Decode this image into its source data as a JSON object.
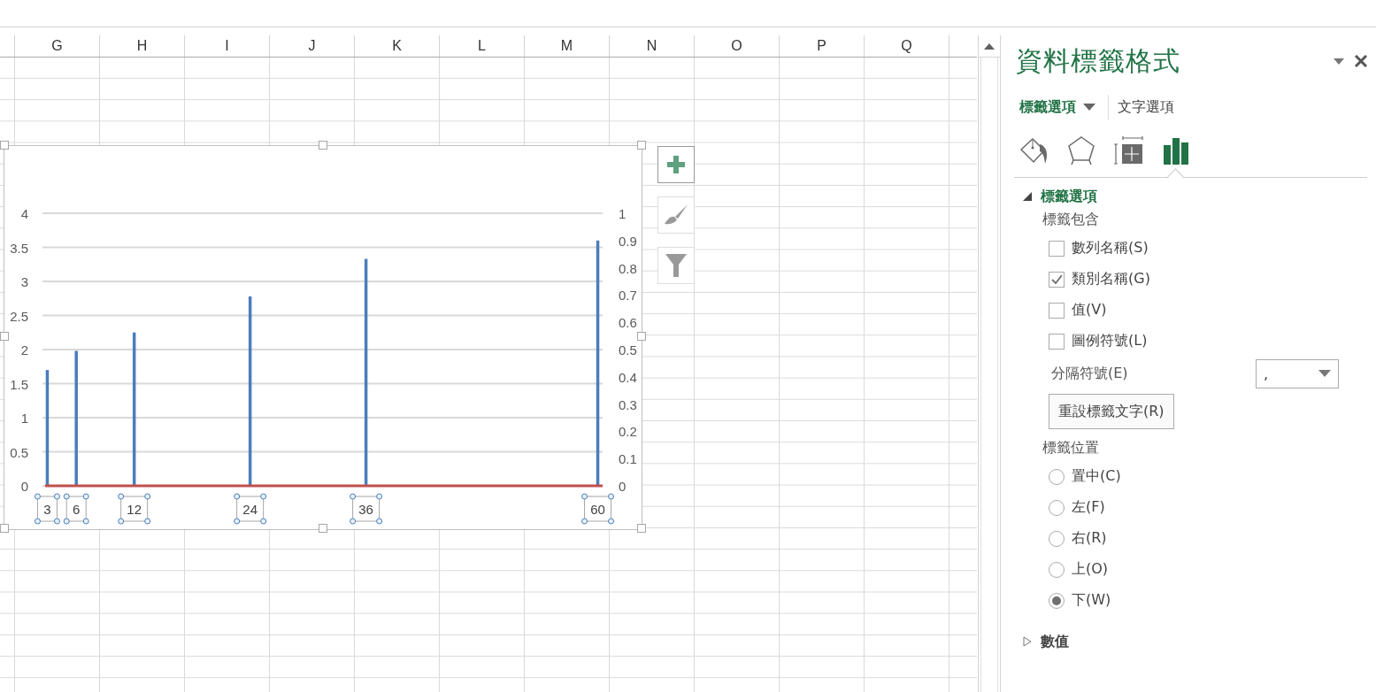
{
  "sheet": {
    "columns": [
      "G",
      "H",
      "I",
      "J",
      "K",
      "L",
      "M",
      "N",
      "O",
      "P",
      "Q"
    ]
  },
  "chart": {
    "right_axis_labels": [
      "1",
      "0.9",
      "0.8",
      "0.7",
      "0.6",
      "0.5",
      "0.4",
      "0.3",
      "0.2",
      "0.1",
      "0"
    ],
    "chart_data": {
      "type": "bar",
      "grid": true,
      "x": [
        3,
        6,
        12,
        24,
        36,
        60
      ],
      "xlim": [
        2.5,
        60.5
      ],
      "ylim": [
        0,
        4
      ],
      "xticks": [
        {
          "value": 3,
          "label": "3"
        },
        {
          "value": 6,
          "label": "6"
        },
        {
          "value": 12,
          "label": "12"
        },
        {
          "value": 24,
          "label": "24"
        },
        {
          "value": 36,
          "label": "36"
        },
        {
          "value": 60,
          "label": "60"
        }
      ],
      "yticks": [
        {
          "value": 0,
          "label": "0"
        },
        {
          "value": 0.5,
          "label": "0.5"
        },
        {
          "value": 1,
          "label": "1"
        },
        {
          "value": 1.5,
          "label": "1.5"
        },
        {
          "value": 2,
          "label": "2"
        },
        {
          "value": 2.5,
          "label": "2.5"
        },
        {
          "value": 3,
          "label": "3"
        },
        {
          "value": 3.5,
          "label": "3.5"
        },
        {
          "value": 4,
          "label": "4"
        }
      ],
      "series": [
        {
          "color": "#4a7ebb",
          "values": [
            1.7,
            1.98,
            2.25,
            2.78,
            3.33,
            3.6
          ]
        },
        {
          "color": "#c0504d",
          "values": [
            0,
            0,
            0,
            0,
            0,
            0
          ]
        }
      ]
    }
  },
  "panel": {
    "title": "資料標籤格式",
    "tabs": [
      {
        "label": "標籤選項",
        "selected": true
      },
      {
        "label": "文字選項",
        "selected": false
      }
    ],
    "icon_tabs": [
      {
        "kind": "fill",
        "selected": false
      },
      {
        "kind": "effects",
        "selected": false
      },
      {
        "kind": "size",
        "selected": false
      },
      {
        "kind": "options",
        "selected": true
      }
    ],
    "sections": [
      {
        "title": "標籤選項",
        "expanded": true,
        "contains_label": "標籤包含",
        "checkboxes": [
          {
            "label": "數列名稱(S)",
            "checked": false
          },
          {
            "label": "類別名稱(G)",
            "checked": true
          },
          {
            "label": "值(V)",
            "checked": false
          },
          {
            "label": "圖例符號(L)",
            "checked": false
          }
        ],
        "separator": {
          "label": "分隔符號(E)",
          "value": ","
        },
        "reset_button": "重設標籤文字(R)",
        "position_label": "標籤位置",
        "positions": [
          {
            "label": "置中(C)",
            "selected": false
          },
          {
            "label": "左(F)",
            "selected": false
          },
          {
            "label": "右(R)",
            "selected": false
          },
          {
            "label": "上(O)",
            "selected": false
          },
          {
            "label": "下(W)",
            "selected": true
          }
        ]
      },
      {
        "title": "數值",
        "expanded": false
      }
    ]
  }
}
